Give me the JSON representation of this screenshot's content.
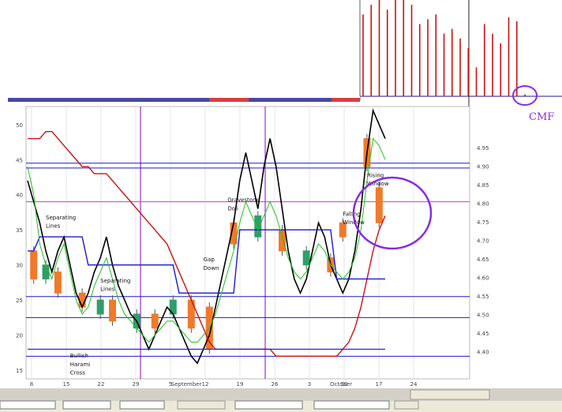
{
  "colors": {
    "price": "#000000",
    "upper_channel": "#1a1acc",
    "lower_channel": "#1a1acc",
    "red_line": "#cc1010",
    "green_lines": "#22c022",
    "bull_candle": "#2e9e6a",
    "bear_candle": "#f07a2a",
    "highlight_circle": "#8a2be2",
    "magenta_line": "#c040c0",
    "cmf_bar": "#cc1010",
    "header_bar": "#1a1a88"
  },
  "chart_data": [
    {
      "type": "bar",
      "name": "CMF",
      "label_text": "CMF",
      "values": [
        0.85,
        0.95,
        1.0,
        0.9,
        1.0,
        1.0,
        0.95,
        0.75,
        0.8,
        0.85,
        0.65,
        0.7,
        0.6,
        0.5,
        0.3,
        0.75,
        0.65,
        0.55,
        0.82,
        0.78,
        0.02
      ]
    },
    {
      "type": "line",
      "title": "",
      "x_tick_labels": [
        "8",
        "15",
        "22",
        "29",
        "5",
        "12",
        "19",
        "26",
        "3",
        "10",
        "17",
        "24"
      ],
      "x_month_labels": [
        "September",
        "October"
      ],
      "y_left_ticks": [
        "50",
        "45",
        "40",
        "35",
        "30",
        "25",
        "20",
        "15"
      ],
      "y_right_ticks": [
        "4.95",
        "4.90",
        "4.85",
        "4.80",
        "4.75",
        "4.70",
        "4.65",
        "4.60",
        "4.55",
        "4.50",
        "4.45",
        "4.40"
      ],
      "ylim": [
        14,
        52
      ],
      "x_count": 60,
      "series": [
        {
          "values": [
            42,
            39,
            36,
            32,
            29,
            32,
            34,
            30,
            26,
            24,
            26,
            29,
            31,
            34,
            30,
            27,
            25,
            23,
            22,
            20,
            18,
            20,
            22,
            24,
            23,
            21,
            19,
            17,
            16,
            18,
            20,
            24,
            28,
            32,
            36,
            42,
            46,
            42,
            38,
            44,
            48,
            44,
            38,
            32,
            28,
            26,
            28,
            32,
            36,
            34,
            30,
            28,
            26,
            28,
            32,
            38,
            46,
            52,
            50,
            48
          ]
        },
        {
          "values": [
            48,
            48,
            48,
            49,
            49,
            48,
            47,
            46,
            45,
            44,
            44,
            43,
            43,
            43,
            42,
            41,
            40,
            39,
            38,
            37,
            36,
            35,
            34,
            33,
            31,
            29,
            27,
            25,
            23,
            21,
            19,
            18,
            18,
            18,
            18,
            18,
            18,
            18,
            18,
            18,
            18,
            17,
            17,
            17,
            17,
            17,
            17,
            17,
            17,
            17,
            17,
            17,
            18,
            19,
            21,
            24,
            28,
            32,
            35,
            37
          ]
        },
        {
          "values": [
            32,
            32,
            34,
            34,
            34,
            34,
            34,
            34,
            34,
            34,
            30,
            30,
            30,
            30,
            30,
            30,
            30,
            30,
            30,
            30,
            30,
            30,
            30,
            30,
            30,
            26,
            26,
            26,
            26,
            26,
            26,
            26,
            26,
            26,
            26,
            35,
            35,
            35,
            35,
            35,
            35,
            35,
            35,
            35,
            35,
            35,
            35,
            35,
            35,
            35,
            35,
            28,
            28,
            28,
            28,
            28,
            28,
            28,
            28,
            28
          ]
        },
        {
          "values": [
            18,
            18,
            18,
            18,
            18,
            18,
            18,
            18,
            18,
            18,
            18,
            18,
            18,
            18,
            18,
            18,
            18,
            18,
            18,
            18,
            18,
            18,
            18,
            18,
            18,
            18,
            18,
            18,
            18,
            18,
            18,
            18,
            18,
            18,
            18,
            18,
            18,
            18,
            18,
            18,
            18,
            18,
            18,
            18,
            18,
            18,
            18,
            18,
            18,
            18,
            18,
            18,
            18,
            18,
            18,
            18,
            18,
            18,
            18,
            18
          ]
        },
        {
          "values": [
            44,
            40,
            33,
            30,
            28,
            31,
            33,
            29,
            25,
            23,
            24,
            27,
            29,
            31,
            28,
            25,
            23,
            22,
            21,
            20,
            19,
            20,
            21,
            22,
            22,
            21,
            20,
            19,
            19,
            20,
            21,
            23,
            26,
            29,
            32,
            36,
            39,
            37,
            35,
            37,
            39,
            37,
            34,
            31,
            29,
            28,
            29,
            31,
            33,
            32,
            30,
            29,
            28,
            29,
            31,
            35,
            42,
            48,
            47,
            45
          ]
        }
      ],
      "bands": [
        {
          "y": 44.5
        },
        {
          "y": 43.8
        },
        {
          "y": 39,
          "color": "magenta"
        },
        {
          "y": 25.5
        },
        {
          "y": 22.5
        },
        {
          "y": 17
        }
      ],
      "candles": [
        {
          "x": 1,
          "open": 32,
          "close": 28,
          "bull": false
        },
        {
          "x": 3,
          "open": 28,
          "close": 30,
          "bull": true
        },
        {
          "x": 5,
          "open": 29,
          "close": 26,
          "bull": false
        },
        {
          "x": 9,
          "open": 26,
          "close": 24,
          "bull": false
        },
        {
          "x": 12,
          "open": 23,
          "close": 25,
          "bull": true
        },
        {
          "x": 14,
          "open": 25,
          "close": 22,
          "bull": false
        },
        {
          "x": 18,
          "open": 21,
          "close": 23,
          "bull": true
        },
        {
          "x": 21,
          "open": 23,
          "close": 21,
          "bull": false
        },
        {
          "x": 24,
          "open": 23,
          "close": 25,
          "bull": true
        },
        {
          "x": 27,
          "open": 25,
          "close": 21,
          "bull": false
        },
        {
          "x": 30,
          "open": 24,
          "close": 18,
          "bull": false
        },
        {
          "x": 34,
          "open": 33,
          "close": 36,
          "bull": false
        },
        {
          "x": 38,
          "open": 34,
          "close": 37,
          "bull": true
        },
        {
          "x": 42,
          "open": 35,
          "close": 32,
          "bull": false
        },
        {
          "x": 46,
          "open": 32,
          "close": 30,
          "bull": true
        },
        {
          "x": 50,
          "open": 31,
          "close": 29,
          "bull": false
        },
        {
          "x": 52,
          "open": 34,
          "close": 36,
          "bull": false
        },
        {
          "x": 56,
          "open": 44,
          "close": 48,
          "bull": false
        },
        {
          "x": 58,
          "open": 41,
          "close": 36,
          "bull": false
        }
      ],
      "annotations": [
        {
          "text": "Separating",
          "x": 3,
          "y": 36.5
        },
        {
          "text": "Lines",
          "x": 3,
          "y": 35.3
        },
        {
          "text": "Separating",
          "x": 12,
          "y": 27.5
        },
        {
          "text": "Lines",
          "x": 12,
          "y": 26.3
        },
        {
          "text": "Gravestone",
          "x": 33,
          "y": 39
        },
        {
          "text": "Doji",
          "x": 33,
          "y": 37.8
        },
        {
          "text": "Gap",
          "x": 29,
          "y": 30.5
        },
        {
          "text": "Down",
          "x": 29,
          "y": 29.3
        },
        {
          "text": "Falling",
          "x": 52,
          "y": 37
        },
        {
          "text": "Window",
          "x": 52,
          "y": 35.8
        },
        {
          "text": "Rising",
          "x": 56,
          "y": 42.5
        },
        {
          "text": "Window",
          "x": 56,
          "y": 41.3
        },
        {
          "text": "Bullish",
          "x": 7,
          "y": 16.8
        },
        {
          "text": "Harami",
          "x": 7,
          "y": 15.6
        },
        {
          "text": "Cross",
          "x": 7,
          "y": 14.4
        }
      ]
    }
  ]
}
